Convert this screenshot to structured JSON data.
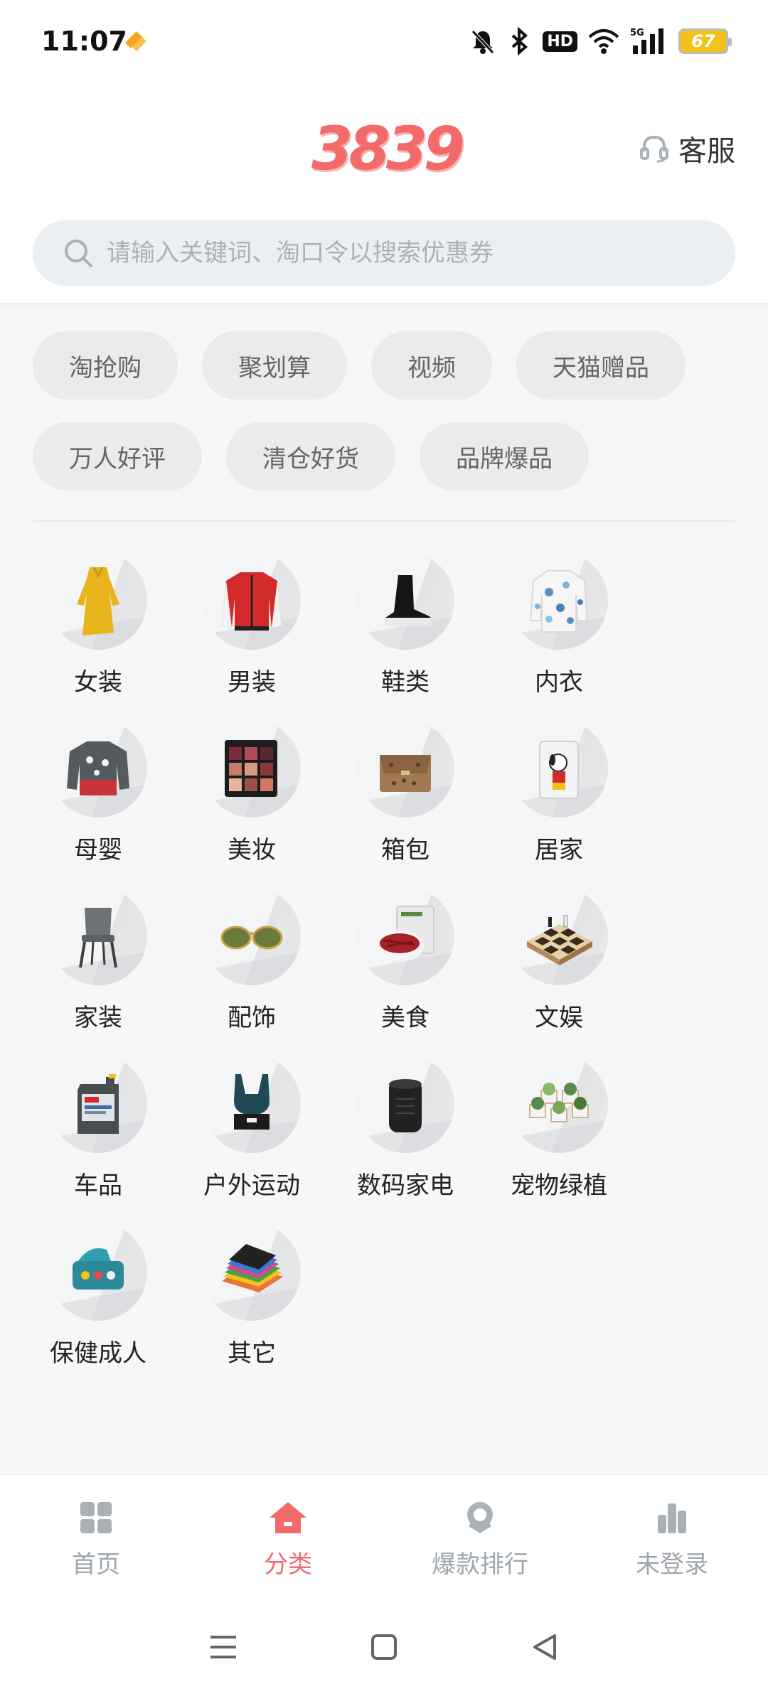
{
  "status_bar": {
    "time": "11:07",
    "network": "5G",
    "hd": "HD",
    "battery": "67"
  },
  "header": {
    "logo": "3839",
    "service_label": "客服",
    "search": {
      "placeholder": "请输入关键词、淘口令以搜索优惠券",
      "value": ""
    }
  },
  "quick_tags": {
    "row1": [
      "淘抢购",
      "聚划算",
      "视频",
      "天猫赠品"
    ],
    "row2": [
      "万人好评",
      "清仓好货",
      "品牌爆品"
    ]
  },
  "categories": [
    {
      "label": "女装",
      "icon": "yellow-dress-icon"
    },
    {
      "label": "男装",
      "icon": "red-jacket-icon"
    },
    {
      "label": "鞋类",
      "icon": "sock-boot-icon"
    },
    {
      "label": "内衣",
      "icon": "floral-shirt-icon"
    },
    {
      "label": "母婴",
      "icon": "baby-sweater-icon"
    },
    {
      "label": "美妆",
      "icon": "eyeshadow-palette-icon"
    },
    {
      "label": "箱包",
      "icon": "snakeskin-bag-icon"
    },
    {
      "label": "居家",
      "icon": "snoopy-cup-icon"
    },
    {
      "label": "家装",
      "icon": "chair-icon"
    },
    {
      "label": "配饰",
      "icon": "sunglasses-icon"
    },
    {
      "label": "美食",
      "icon": "jerky-snack-icon"
    },
    {
      "label": "文娱",
      "icon": "chessboard-icon"
    },
    {
      "label": "车品",
      "icon": "engine-oil-icon"
    },
    {
      "label": "户外运动",
      "icon": "sports-bra-icon"
    },
    {
      "label": "数码家电",
      "icon": "speaker-icon"
    },
    {
      "label": "宠物绿植",
      "icon": "succulents-icon"
    },
    {
      "label": "保健成人",
      "icon": "pill-box-icon"
    },
    {
      "label": "其它",
      "icon": "notebooks-icon"
    }
  ],
  "bottom_nav": [
    {
      "label": "首页",
      "icon": "home-grid-icon",
      "active": false
    },
    {
      "label": "分类",
      "icon": "category-house-icon",
      "active": true
    },
    {
      "label": "爆款排行",
      "icon": "ranking-badge-icon",
      "active": false
    },
    {
      "label": "未登录",
      "icon": "profile-bars-icon",
      "active": false
    }
  ],
  "colors": {
    "accent": "#f26a6a",
    "inactive": "#9ea6ac",
    "tag_bg": "#e9ebec",
    "search_bg": "#eceff1"
  }
}
